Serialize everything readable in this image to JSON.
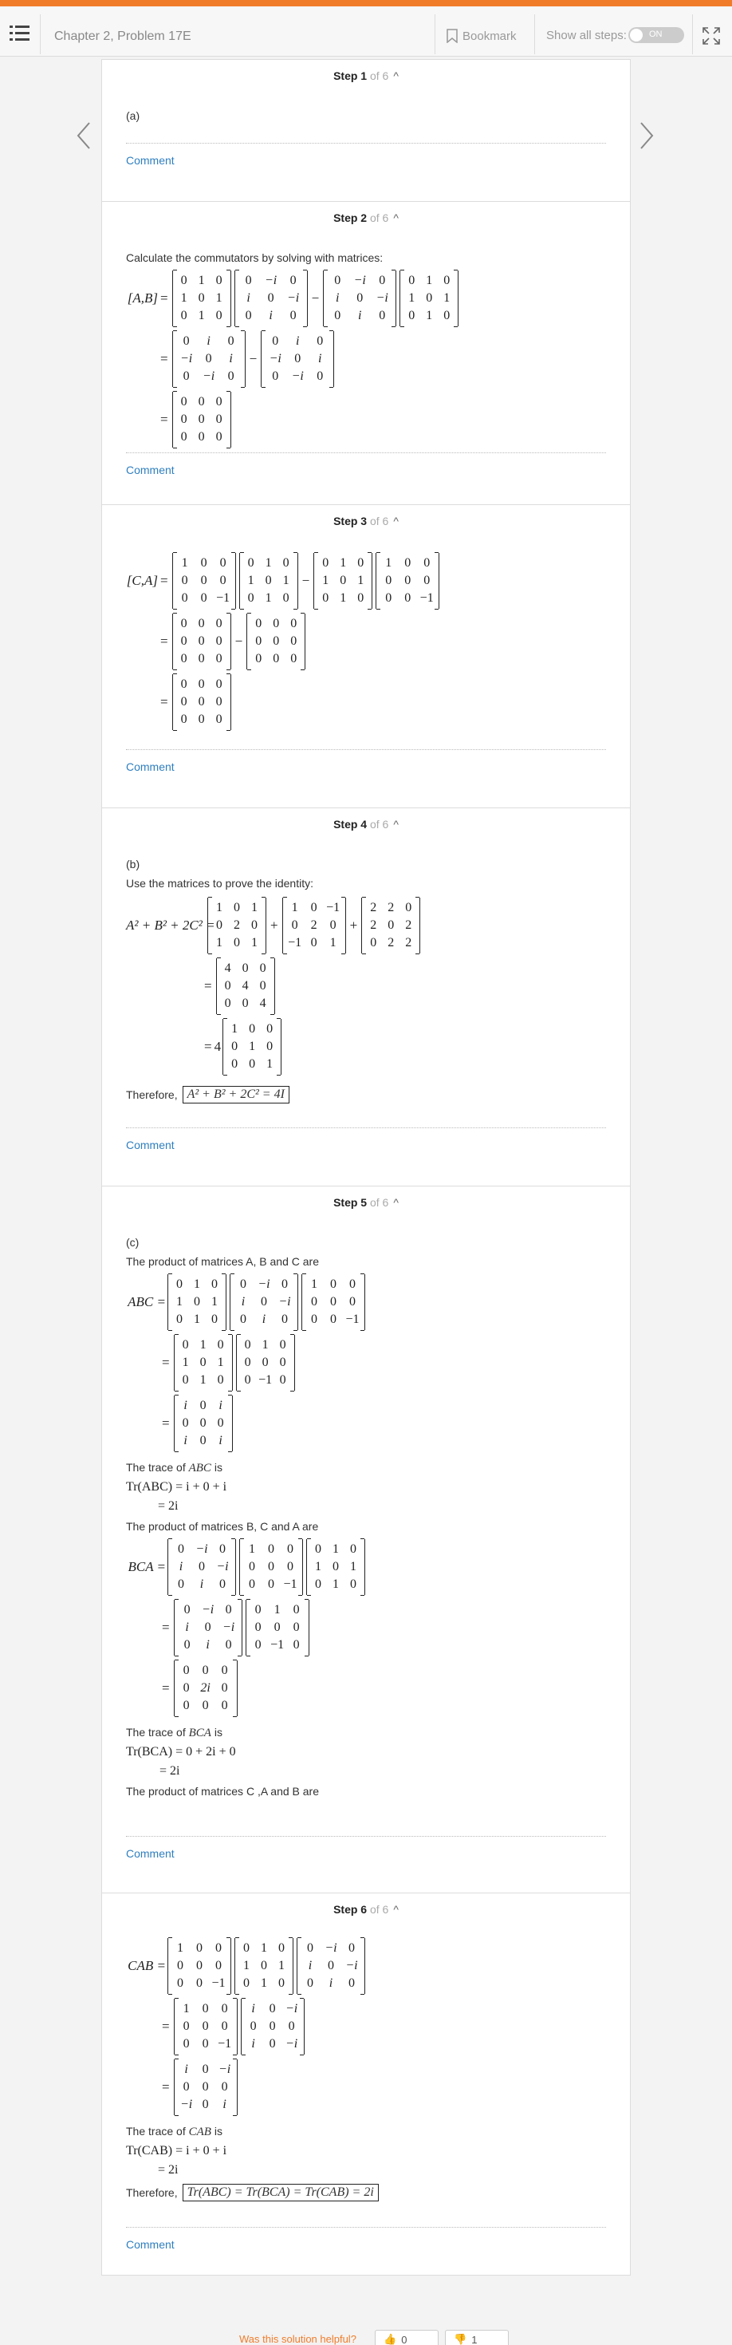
{
  "header": {
    "title": "Chapter 2, Problem 17E",
    "bookmark_label": "Bookmark",
    "show_steps_label": "Show all steps:",
    "toggle_label": "ON"
  },
  "steps": [
    {
      "label": "Step 1",
      "of": "of 6",
      "part": "(a)",
      "comment": "Comment"
    },
    {
      "label": "Step 2",
      "of": "of 6",
      "intro": "Calculate the commutators by solving with matrices:",
      "comment": "Comment"
    },
    {
      "label": "Step 3",
      "of": "of 6",
      "comment": "Comment"
    },
    {
      "label": "Step 4",
      "of": "of 6",
      "part": "(b)",
      "intro": "Use the matrices to prove the identity:",
      "therefore": "Therefore,",
      "result": "A² + B² + 2C² = 4I",
      "comment": "Comment"
    },
    {
      "label": "Step 5",
      "of": "of 6",
      "part": "(c)",
      "intro": "The product of matrices A, B and C are",
      "trace_abc": "The trace of",
      "trace_abc_sym": "ABC",
      "is": "is",
      "intro_bca": "The product of matrices B, C and A are",
      "trace_bca_sym": "BCA",
      "intro_cab": "The product of matrices C ,A and B are",
      "comment": "Comment"
    },
    {
      "label": "Step 6",
      "of": "of 6",
      "trace_cab_sym": "CAB",
      "therefore": "Therefore,",
      "result": "Tr(ABC) = Tr(BCA) = Tr(CAB) = 2i",
      "comment": "Comment"
    }
  ],
  "math": {
    "AB": "[A,B]",
    "CA": "[C,A]",
    "eq": "=",
    "minus": "−",
    "plus": "+",
    "A2": "A² + B² + 2C² =",
    "four": "4",
    "ABC": "ABC =",
    "BCA": "BCA =",
    "CAB": "CAB =",
    "tr_abc_1": "Tr(ABC) = i + 0 + i",
    "tr_abc_2": "= 2i",
    "tr_bca_1": "Tr(BCA) = 0 + 2i + 0",
    "tr_bca_2": "= 2i",
    "tr_cab_1": "Tr(CAB) = i + 0 + i",
    "tr_cab_2": "= 2i"
  },
  "matrices": {
    "A": [
      "0",
      "1",
      "0",
      "1",
      "0",
      "1",
      "0",
      "1",
      "0"
    ],
    "B": [
      "0",
      "−i",
      "0",
      "i",
      "0",
      "−i",
      "0",
      "i",
      "0"
    ],
    "C": [
      "1",
      "0",
      "0",
      "0",
      "0",
      "0",
      "0",
      "0",
      "−1"
    ],
    "Z": [
      "0",
      "0",
      "0",
      "0",
      "0",
      "0",
      "0",
      "0",
      "0"
    ],
    "s2_l": [
      "0",
      "i",
      "0",
      "−i",
      "0",
      "i",
      "0",
      "−i",
      "0"
    ],
    "s2_r": [
      "0",
      "i",
      "0",
      "−i",
      "0",
      "i",
      "0",
      "−i",
      "0"
    ],
    "s3_l": [
      "0",
      "0",
      "0",
      "0",
      "0",
      "0",
      "0",
      "0",
      "0"
    ],
    "A2": [
      "1",
      "0",
      "1",
      "0",
      "2",
      "0",
      "1",
      "0",
      "1"
    ],
    "B2": [
      "1",
      "0",
      "−1",
      "0",
      "2",
      "0",
      "−1",
      "0",
      "1"
    ],
    "C2": [
      "2",
      "2",
      "0",
      "2",
      "0",
      "2",
      "0",
      "2",
      "2"
    ],
    "s4_sum": [
      "4",
      "0",
      "0",
      "0",
      "4",
      "0",
      "0",
      "0",
      "4"
    ],
    "I": [
      "1",
      "0",
      "0",
      "0",
      "1",
      "0",
      "0",
      "0",
      "1"
    ],
    "AB_prod": [
      "i",
      "0",
      "−i",
      "0",
      "0",
      "0",
      "i",
      "0",
      "−i"
    ],
    "ABC_res": [
      "i",
      "0",
      "i",
      "0",
      "0",
      "0",
      "i",
      "0",
      "i"
    ],
    "BC_prod": [
      "0",
      "−i",
      "0",
      "i",
      "0",
      "−i",
      "0",
      "i",
      "0"
    ],
    "BC_prod2": [
      "0",
      "1",
      "0",
      "0",
      "0",
      "0",
      "0",
      "−1",
      "0"
    ],
    "BCA_res": [
      "0",
      "0",
      "0",
      "0",
      "2i",
      "0",
      "0",
      "0",
      "0"
    ],
    "CA_prod": [
      "1",
      "0",
      "0",
      "0",
      "0",
      "0",
      "0",
      "0",
      "−1"
    ],
    "CA_prod2": [
      "i",
      "0",
      "−i",
      "0",
      "0",
      "0",
      "i",
      "0",
      "−i"
    ],
    "CAB_res": [
      "i",
      "0",
      "−i",
      "0",
      "0",
      "0",
      "−i",
      "0",
      "i"
    ]
  },
  "footer": {
    "helpful": "Was this solution helpful?",
    "up_count": "0",
    "down_count": "1"
  }
}
